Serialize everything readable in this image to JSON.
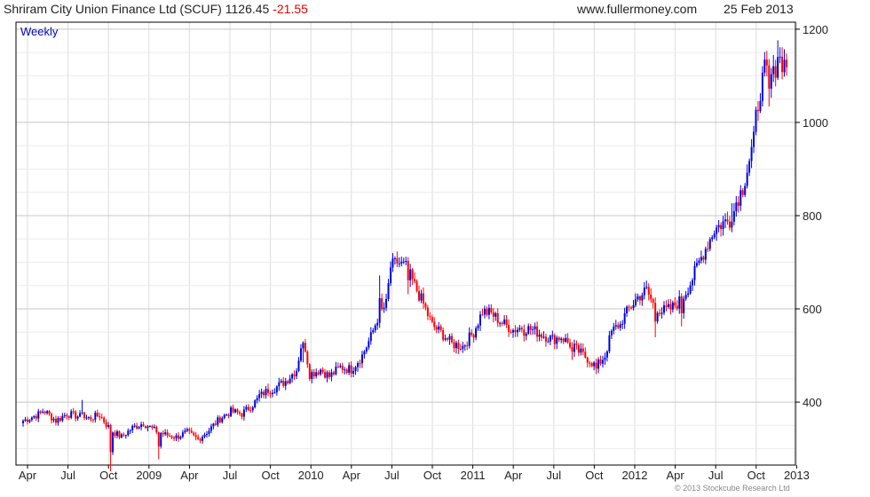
{
  "header": {
    "name": "Shriram City Union Finance Ltd (SCUF)",
    "price": "1126.45",
    "change": "-21.55",
    "source": "www.fullermoney.com",
    "date": "25 Feb 2013"
  },
  "footer": {
    "copyright": "© 2013 Stockcube Research Ltd"
  },
  "chart_data": {
    "type": "candlestick",
    "label": "Weekly",
    "ylim": [
      265,
      1215
    ],
    "y_ticks": [
      400,
      600,
      800,
      1000,
      1200
    ],
    "x_ticks": [
      "Apr",
      "Jul",
      "Oct",
      "2009",
      "Apr",
      "Jul",
      "Oct",
      "2010",
      "Apr",
      "Jul",
      "Oct",
      "2011",
      "Apr",
      "Jul",
      "Oct",
      "2012",
      "Apr",
      "Jul",
      "Oct",
      "2013"
    ],
    "grid": true,
    "colors": {
      "up": "#0000e0",
      "down": "#ff0000",
      "grid": "#dddddd",
      "axis": "#000000",
      "label": "#0000c0"
    },
    "close_path": [
      [
        0,
        360
      ],
      [
        5,
        370
      ],
      [
        10,
        380
      ],
      [
        15,
        360
      ],
      [
        20,
        375
      ],
      [
        25,
        370
      ],
      [
        30,
        365
      ],
      [
        35,
        372
      ],
      [
        40,
        340
      ],
      [
        45,
        325
      ],
      [
        50,
        345
      ],
      [
        55,
        355
      ],
      [
        60,
        340
      ],
      [
        65,
        330
      ],
      [
        70,
        325
      ],
      [
        75,
        335
      ],
      [
        80,
        320
      ],
      [
        85,
        340
      ],
      [
        90,
        365
      ],
      [
        95,
        380
      ],
      [
        100,
        375
      ],
      [
        105,
        395
      ],
      [
        110,
        420
      ],
      [
        115,
        430
      ],
      [
        120,
        445
      ],
      [
        125,
        470
      ],
      [
        128,
        545
      ],
      [
        131,
        460
      ],
      [
        136,
        470
      ],
      [
        140,
        455
      ],
      [
        145,
        475
      ],
      [
        150,
        470
      ],
      [
        155,
        500
      ],
      [
        159,
        540
      ],
      [
        162,
        580
      ],
      [
        166,
        610
      ],
      [
        168,
        690
      ],
      [
        171,
        700
      ],
      [
        175,
        690
      ],
      [
        179,
        650
      ],
      [
        183,
        610
      ],
      [
        187,
        565
      ],
      [
        192,
        545
      ],
      [
        196,
        525
      ],
      [
        201,
        520
      ],
      [
        206,
        550
      ],
      [
        210,
        595
      ],
      [
        214,
        590
      ],
      [
        219,
        570
      ],
      [
        224,
        555
      ],
      [
        228,
        560
      ],
      [
        233,
        555
      ],
      [
        237,
        545
      ],
      [
        242,
        535
      ],
      [
        246,
        540
      ],
      [
        251,
        520
      ],
      [
        255,
        505
      ],
      [
        259,
        490
      ],
      [
        262,
        475
      ],
      [
        266,
        500
      ],
      [
        269,
        550
      ],
      [
        273,
        570
      ],
      [
        277,
        600
      ],
      [
        281,
        625
      ],
      [
        285,
        640
      ],
      [
        288,
        610
      ],
      [
        292,
        595
      ],
      [
        296,
        600
      ],
      [
        301,
        620
      ],
      [
        305,
        655
      ],
      [
        309,
        700
      ],
      [
        312,
        730
      ],
      [
        316,
        770
      ],
      [
        320,
        785
      ],
      [
        324,
        790
      ],
      [
        326,
        830
      ],
      [
        329,
        860
      ],
      [
        332,
        920
      ],
      [
        334,
        960
      ],
      [
        335,
        1010
      ],
      [
        337,
        1070
      ],
      [
        339,
        1110
      ],
      [
        341,
        1100
      ],
      [
        343,
        1100
      ],
      [
        345,
        1140
      ],
      [
        347,
        1130
      ],
      [
        349,
        1125
      ]
    ],
    "volatile_weeks": [
      [
        9,
        3
      ],
      [
        27,
        15
      ],
      [
        40,
        -45
      ],
      [
        62,
        -30
      ],
      [
        108,
        4
      ],
      [
        112,
        2
      ],
      [
        128,
        -25
      ],
      [
        163,
        25
      ],
      [
        176,
        -20
      ],
      [
        229,
        -5
      ],
      [
        251,
        -15
      ],
      [
        262,
        -5
      ],
      [
        273,
        -5
      ],
      [
        289,
        -30
      ],
      [
        301,
        -25
      ],
      [
        324,
        15
      ],
      [
        341,
        -40
      ],
      [
        345,
        10
      ]
    ]
  }
}
